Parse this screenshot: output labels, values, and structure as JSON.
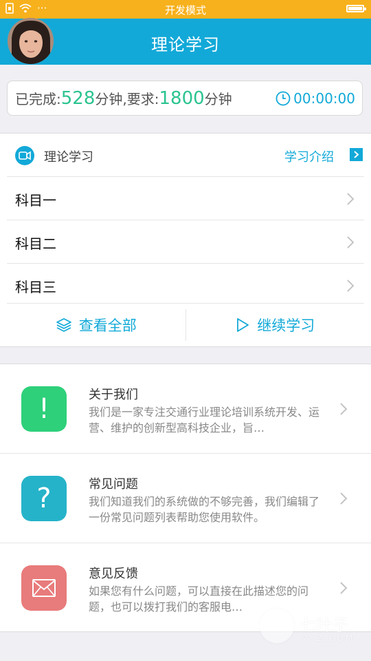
{
  "status_bar": {
    "center": "开发模式",
    "dots": "···"
  },
  "header": {
    "title": "理论学习"
  },
  "progress": {
    "completed_label": "已完成:",
    "completed_value": "528",
    "unit1": "分钟,要求:",
    "required_value": "1800",
    "unit2": "分钟",
    "timer": "00:00:00"
  },
  "course": {
    "label": "理论学习",
    "intro": "学习介绍",
    "subjects": [
      {
        "label": "科目一"
      },
      {
        "label": "科目二"
      },
      {
        "label": "科目三"
      }
    ],
    "view_all": "查看全部",
    "continue": "继续学习"
  },
  "info": [
    {
      "title": "关于我们",
      "desc": "我们是一家专注交通行业理论培训系统开发、运营、维护的创新型高科技企业，旨…",
      "icon": "exclamation-icon",
      "color": "#2ed07a",
      "glyph": "!"
    },
    {
      "title": "常见问题",
      "desc": "我们知道我们的系统做的不够完善，我们编辑了一份常见问题列表帮助您使用软件。",
      "icon": "question-icon",
      "color": "#25b3c9",
      "glyph": "?"
    },
    {
      "title": "意见反馈",
      "desc": "如果您有什么问题，可以直接在此描述您的问题，也可以拨打我们的客服电…",
      "icon": "mail-icon",
      "color": "#e87b7b",
      "glyph": ""
    }
  ],
  "watermark": {
    "brand": "七叶子",
    "domain": "7YZ.COM"
  },
  "colors": {
    "accent": "#12a9d8",
    "status": "#f7b11c",
    "highlight": "#2bc48f"
  }
}
